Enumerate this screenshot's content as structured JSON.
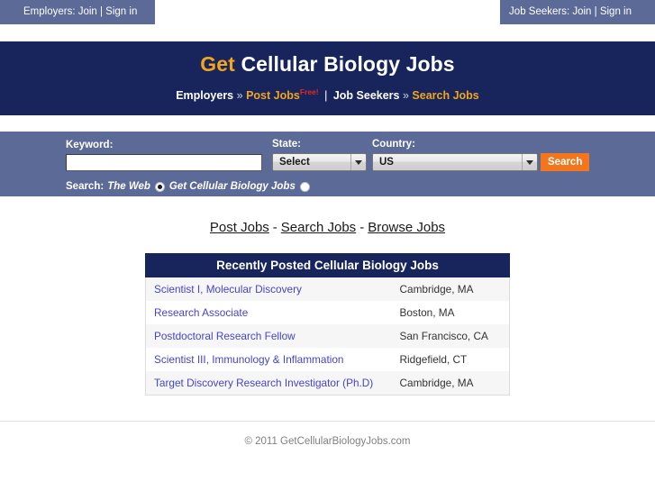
{
  "topbar": {
    "employers_text": "Employers: Join | Sign in",
    "jobseekers_text": "Job Seekers: Join | Sign in"
  },
  "banner": {
    "title_accent": "Get",
    "title_rest": " Cellular Biology Jobs",
    "sub_employers": "Employers",
    "chevron1": "»",
    "sub_post_jobs": "Post Jobs",
    "free_badge": "Free!",
    "pipe": "|",
    "sub_jobseekers": "Job Seekers",
    "chevron2": "»",
    "sub_search_jobs": "Search Jobs"
  },
  "search": {
    "keyword_label": "Keyword:",
    "keyword_value": "",
    "keyword_placeholder": "",
    "state_label": "State:",
    "state_selected": "Select",
    "country_label": "Country:",
    "country_selected": "US",
    "search_button": "Search",
    "radio_prefix": "Search:",
    "radio_web_label": "The Web",
    "radio_site_label": "Get Cellular Biology Jobs",
    "radio_web_checked": true,
    "radio_site_checked": false
  },
  "midnav": {
    "post_jobs": "Post Jobs",
    "sep1": "-",
    "search_jobs": "Search Jobs",
    "sep2": "-",
    "browse_jobs": "Browse Jobs"
  },
  "jobs_table": {
    "heading": "Recently Posted Cellular Biology Jobs",
    "rows": [
      {
        "title": "Scientist I, Molecular Discovery",
        "location": "Cambridge, MA"
      },
      {
        "title": "Research Associate",
        "location": "Boston, MA"
      },
      {
        "title": "Postdoctoral Research Fellow",
        "location": "San Francisco, CA"
      },
      {
        "title": "Scientist III, Immunology & Inflammation",
        "location": "Ridgefield, CT"
      },
      {
        "title": "Target Discovery Research Investigator (Ph.D)",
        "location": "Cambridge, MA"
      }
    ]
  },
  "footer": {
    "copyright": "© 2011 GetCellularBiologyJobs.com"
  },
  "colors": {
    "navy": "#17255c",
    "panel_blue": "#5c6a98",
    "accent_orange": "#f2a51a",
    "button_orange": "#f3761d",
    "link_blue": "#4444cc",
    "free_red": "#e8261c"
  }
}
